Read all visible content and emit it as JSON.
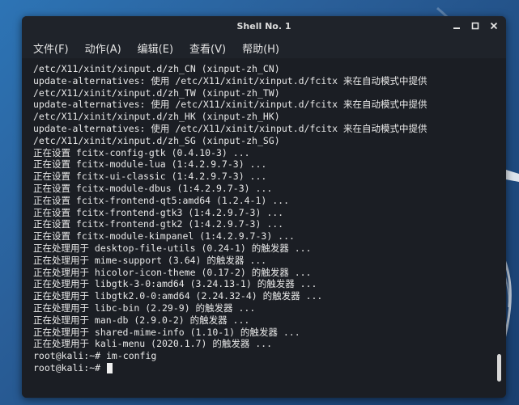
{
  "window": {
    "title": "Shell No. 1"
  },
  "menu": {
    "items": [
      {
        "label": "文件(F)"
      },
      {
        "label": "动作(A)"
      },
      {
        "label": "编辑(E)"
      },
      {
        "label": "查看(V)"
      },
      {
        "label": "帮助(H)"
      }
    ]
  },
  "terminal": {
    "lines": [
      "/etc/X11/xinit/xinput.d/zh_CN (xinput-zh_CN)",
      "update-alternatives: 使用 /etc/X11/xinit/xinput.d/fcitx 来在自动模式中提供",
      "/etc/X11/xinit/xinput.d/zh_TW (xinput-zh_TW)",
      "update-alternatives: 使用 /etc/X11/xinit/xinput.d/fcitx 来在自动模式中提供",
      "/etc/X11/xinit/xinput.d/zh_HK (xinput-zh_HK)",
      "update-alternatives: 使用 /etc/X11/xinit/xinput.d/fcitx 来在自动模式中提供",
      "/etc/X11/xinit/xinput.d/zh_SG (xinput-zh_SG)",
      "正在设置 fcitx-config-gtk (0.4.10-3) ...",
      "正在设置 fcitx-module-lua (1:4.2.9.7-3) ...",
      "正在设置 fcitx-ui-classic (1:4.2.9.7-3) ...",
      "正在设置 fcitx-module-dbus (1:4.2.9.7-3) ...",
      "正在设置 fcitx-frontend-qt5:amd64 (1.2.4-1) ...",
      "正在设置 fcitx-frontend-gtk3 (1:4.2.9.7-3) ...",
      "正在设置 fcitx-frontend-gtk2 (1:4.2.9.7-3) ...",
      "正在设置 fcitx-module-kimpanel (1:4.2.9.7-3) ...",
      "正在处理用于 desktop-file-utils (0.24-1) 的触发器 ...",
      "正在处理用于 mime-support (3.64) 的触发器 ...",
      "正在处理用于 hicolor-icon-theme (0.17-2) 的触发器 ...",
      "正在处理用于 libgtk-3-0:amd64 (3.24.13-1) 的触发器 ...",
      "正在处理用于 libgtk2.0-0:amd64 (2.24.32-4) 的触发器 ...",
      "正在处理用于 libc-bin (2.29-9) 的触发器 ...",
      "正在处理用于 man-db (2.9.0-2) 的触发器 ...",
      "正在处理用于 shared-mime-info (1.10-1) 的触发器 ...",
      "正在处理用于 kali-menu (2020.1.7) 的触发器 ...",
      "root@kali:~# im-config"
    ],
    "prompt": "root@kali:~# "
  }
}
